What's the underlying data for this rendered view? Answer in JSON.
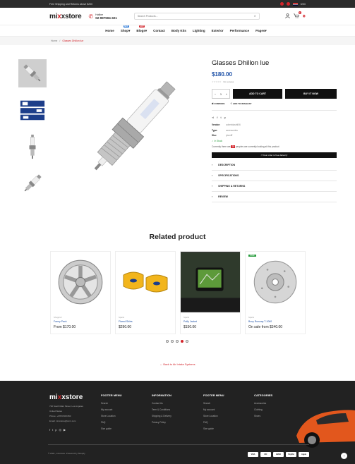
{
  "topbar": {
    "promo": "Free Shipping and Returns above $200",
    "wishlist_count": "0",
    "compare_count": "0",
    "currency": "USD"
  },
  "header": {
    "logo_main": "mi",
    "logo_x": "x",
    "logo_rest": "xstore",
    "hotline_label": "Hotline",
    "hotline_number": "02-997504-321",
    "search_placeholder": "Search Products...",
    "cart_count": "0"
  },
  "nav": {
    "items": [
      {
        "label": "Home"
      },
      {
        "label": "Shop",
        "badge": "NEW",
        "badge_color": "#1b6fd6",
        "caret": "▾"
      },
      {
        "label": "Blogs",
        "badge": "HOT",
        "badge_color": "#d3242b",
        "caret": "▾"
      },
      {
        "label": "Contact"
      },
      {
        "label": "Body Kits"
      },
      {
        "label": "Lighting"
      },
      {
        "label": "Exterior"
      },
      {
        "label": "Performance"
      },
      {
        "label": "Pages",
        "caret": "▾"
      }
    ]
  },
  "breadcrumb": {
    "home": "Home",
    "sep": "/",
    "current": "Glasses Dhillon lue"
  },
  "product": {
    "title": "Glasses Dhillon lue",
    "price": "$180.00",
    "stars": "☆☆☆☆☆",
    "reviews": "No reviews",
    "qty_minus": "−",
    "qty_value": "1",
    "qty_plus": "+",
    "add_to_cart": "ADD TO CART",
    "buy_now": "BUY IT NOW",
    "compare": "COMPARE",
    "wishlist": "ADD TO WISHLIST",
    "vendor_label": "Vendor:",
    "vendor_value": "zoheirdashti06",
    "type_label": "Type:",
    "type_value": "accessories",
    "sku_label": "Sku:",
    "sku_value": "yboxfff",
    "stock": "In Stock",
    "viewers_pre": "Currently there are",
    "viewers_count": "25",
    "viewers_post": "peoples are currently looking at this product",
    "delivery": "Your order is free delivery!",
    "accordion": [
      "DESCRIPTION",
      "SPECIFICATIONS",
      "SHIPPING & RETURNS",
      "REVIEW"
    ]
  },
  "related": {
    "title": "Related product",
    "cards": [
      {
        "vendor": "Shopprof",
        "name": "Fanny Pack",
        "price": "From $170.00",
        "tag": ""
      },
      {
        "vendor": "Sparts",
        "name": "Flared Skirts",
        "price": "$290.00",
        "tag": ""
      },
      {
        "vendor": "Sparts",
        "name": "Puffy Jacket",
        "price": "$150.00",
        "tag": ""
      },
      {
        "vendor": "Sparts",
        "name": "Boxy Runway T-1060",
        "price": "On sale from $340.00",
        "tag": "SALE"
      }
    ],
    "back_link": "← Back to Air Intake Systems"
  },
  "footer": {
    "address": "720 South Main Street, Los Angeles",
    "country": "United States",
    "phone": "Phone: +0783 808 860",
    "email": "Email: mixxstore@corn.com",
    "cols": [
      {
        "title": "FOOTER MENU",
        "items": [
          "Search",
          "My account",
          "Store Location",
          "FAQ",
          "Size guide"
        ]
      },
      {
        "title": "INFORMATION",
        "items": [
          "Contact Us",
          "Term & Conditions",
          "Shipping & Delivery",
          "Privacy Policy"
        ]
      },
      {
        "title": "FOOTER MENU",
        "items": [
          "Search",
          "My account",
          "Store Location",
          "FAQ",
          "Size guide"
        ]
      },
      {
        "title": "CATEGORIES",
        "items": [
          "Accessories",
          "Clothing",
          "Shoes"
        ]
      }
    ],
    "copyright": "© 2021, mixxstore. Powered by Shopify",
    "payments": [
      "VISA",
      "MC",
      "AMEX",
      "PayPal",
      "Apple"
    ]
  }
}
